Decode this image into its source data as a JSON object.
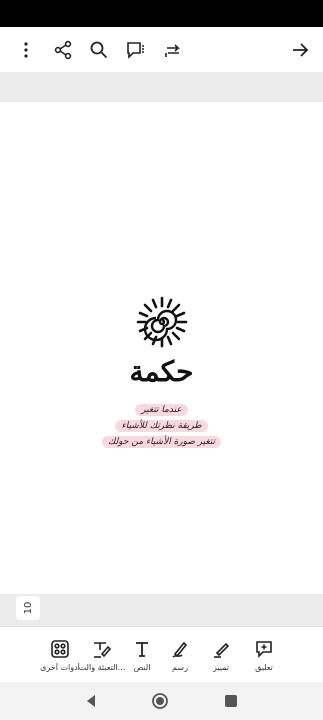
{
  "page": {
    "number": "10"
  },
  "document": {
    "title": "حكمة",
    "lines": [
      "عندما تتغير",
      "طريقة نظرتك للأشياء",
      "تتغير صورة الأشياء من حولك"
    ]
  },
  "tools": [
    {
      "label": "تعليق",
      "icon": "comment-add-icon"
    },
    {
      "label": "تمييز",
      "icon": "highlighter-icon"
    },
    {
      "label": "رسم",
      "icon": "draw-pen-icon"
    },
    {
      "label": "النص",
      "icon": "text-icon"
    },
    {
      "label": "التعبئة والت...",
      "icon": "fill-sign-icon"
    },
    {
      "label": "أدوات أخرى",
      "icon": "more-tools-icon"
    }
  ],
  "toolbar_icons": [
    "back-arrow-icon",
    "share-icon",
    "search-icon",
    "comments-icon",
    "redo-icon",
    "menu-icon"
  ],
  "colors": {
    "highlight": "#f0aabe",
    "accent": "#000000"
  }
}
